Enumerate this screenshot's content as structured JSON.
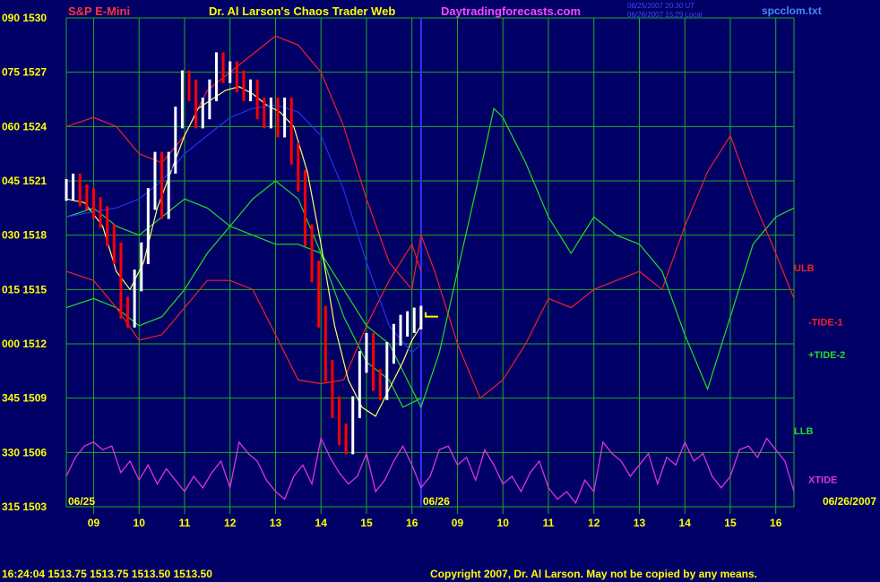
{
  "header": {
    "instrument": "S&P E-Mini",
    "title": "Dr. Al Larson's Chaos Trader Web",
    "site": "Daytradingforecasts.com",
    "stamp_line1": "06/25/2007 20:30 UT",
    "stamp_line2": "06/26/2007 15:29 Local",
    "filename": "spcclom.txt"
  },
  "footer": {
    "quote": "16:24:04  1513.75 1513.75 1513.50 1513.50",
    "copyright": "Copyright 2007, Dr. Al Larson. May not be copied by any means."
  },
  "colors": {
    "background": "#000066",
    "grid": "#22aa22",
    "price_up": "#ffffff",
    "price_down": "#ff0000",
    "ulb": "#ee2222",
    "llb": "#22dd22",
    "tide1": "#ee2222",
    "tide2": "#22dd22",
    "xtide": "#dd33dd",
    "fast_avg": "#ffff66",
    "slow_avg": "#2233ee",
    "labels": "#ffff00",
    "divider": "#3333ff"
  },
  "chart_data": {
    "type": "line",
    "y_labels": [
      {
        "angle": "090",
        "price": 1530
      },
      {
        "angle": "075",
        "price": 1527
      },
      {
        "angle": "060",
        "price": 1524
      },
      {
        "angle": "045",
        "price": 1521
      },
      {
        "angle": "030",
        "price": 1518
      },
      {
        "angle": "015",
        "price": 1515
      },
      {
        "angle": "000",
        "price": 1512
      },
      {
        "angle": "345",
        "price": 1509
      },
      {
        "angle": "330",
        "price": 1506
      },
      {
        "angle": "315",
        "price": 1503
      }
    ],
    "ylim": [
      1503,
      1530
    ],
    "xlim": [
      8.4,
      24.4
    ],
    "x_ticks": [
      {
        "x": 9.0,
        "label": "09"
      },
      {
        "x": 10.0,
        "label": "10"
      },
      {
        "x": 11.0,
        "label": "11"
      },
      {
        "x": 12.0,
        "label": "12"
      },
      {
        "x": 13.0,
        "label": "13"
      },
      {
        "x": 14.0,
        "label": "14"
      },
      {
        "x": 15.0,
        "label": "15"
      },
      {
        "x": 16.0,
        "label": "16"
      },
      {
        "x": 17.0,
        "label": "09"
      },
      {
        "x": 18.0,
        "label": "10"
      },
      {
        "x": 19.0,
        "label": "11"
      },
      {
        "x": 20.0,
        "label": "12"
      },
      {
        "x": 21.0,
        "label": "13"
      },
      {
        "x": 22.0,
        "label": "14"
      },
      {
        "x": 23.0,
        "label": "15"
      },
      {
        "x": 24.0,
        "label": "16"
      }
    ],
    "day_divider_x": 16.2,
    "dates": [
      {
        "x": 8.4,
        "label": "06/25"
      },
      {
        "x": 16.2,
        "label": "06/26"
      },
      {
        "x": 24.4,
        "label": "06/26/2007"
      }
    ],
    "price_series": {
      "name": "price",
      "x": [
        8.4,
        8.55,
        8.7,
        8.85,
        9.0,
        9.15,
        9.3,
        9.45,
        9.6,
        9.75,
        9.9,
        10.05,
        10.2,
        10.35,
        10.5,
        10.65,
        10.8,
        10.95,
        11.1,
        11.25,
        11.4,
        11.55,
        11.7,
        11.85,
        12.0,
        12.15,
        12.3,
        12.45,
        12.6,
        12.75,
        12.9,
        13.05,
        13.2,
        13.35,
        13.5,
        13.65,
        13.8,
        13.95,
        14.1,
        14.25,
        14.4,
        14.55,
        14.7,
        14.85,
        15.0,
        15.15,
        15.3,
        15.45,
        15.6,
        15.75,
        15.9,
        16.05,
        16.2
      ],
      "y": [
        1520.5,
        1520.8,
        1520.2,
        1520.0,
        1519.5,
        1519.0,
        1518.0,
        1517.0,
        1514.0,
        1513.5,
        1515.5,
        1517.0,
        1520.0,
        1522.0,
        1519.5,
        1522.0,
        1524.5,
        1526.5,
        1526.0,
        1524.5,
        1525.0,
        1526.0,
        1527.5,
        1527.0,
        1527.0,
        1526.5,
        1526.0,
        1526.0,
        1525.0,
        1524.5,
        1525.0,
        1524.0,
        1525.0,
        1522.5,
        1521.0,
        1518.0,
        1516.0,
        1513.5,
        1510.5,
        1508.5,
        1507.0,
        1506.5,
        1508.5,
        1511.0,
        1512.0,
        1510.0,
        1509.5,
        1511.5,
        1512.5,
        1513.0,
        1513.2,
        1513.4,
        1513.5
      ]
    },
    "forecast_marker": {
      "x": 16.3,
      "y": 1513.5
    },
    "series": [
      {
        "name": "ULB",
        "x": [
          8.4,
          9.0,
          9.5,
          10.0,
          10.5,
          11.0,
          11.5,
          12.0,
          12.5,
          13.0,
          13.5,
          14.0,
          14.5,
          15.0,
          15.5,
          16.0,
          16.2,
          16.5,
          17.0,
          17.5,
          18.0,
          18.5,
          19.0,
          19.5,
          20.0,
          20.5,
          21.0,
          21.5,
          22.0,
          22.5,
          23.0,
          23.5,
          24.0,
          24.4
        ],
        "y": [
          1524.0,
          1524.5,
          1524.0,
          1522.5,
          1522.0,
          1523.5,
          1526.0,
          1527.0,
          1528.0,
          1529.0,
          1528.5,
          1527.0,
          1524.0,
          1520.0,
          1516.5,
          1515.0,
          1518.0,
          1516.0,
          1512.0,
          1509.0,
          1510.0,
          1512.0,
          1514.5,
          1514.0,
          1515.0,
          1515.5,
          1516.0,
          1515.0,
          1518.5,
          1521.5,
          1523.5,
          1520.0,
          1517.0,
          1514.5
        ]
      },
      {
        "name": "LLB",
        "x": [
          8.4,
          9.0,
          9.5,
          10.0,
          10.5,
          11.0,
          11.5,
          12.0,
          12.5,
          13.0,
          13.5,
          14.0,
          14.5,
          15.0,
          15.5,
          15.8,
          16.2
        ],
        "y": [
          1514.0,
          1514.5,
          1514.0,
          1513.0,
          1513.5,
          1515.0,
          1517.0,
          1518.5,
          1520.0,
          1521.0,
          1520.0,
          1517.0,
          1513.5,
          1511.0,
          1510.0,
          1508.5,
          1509.0
        ]
      },
      {
        "name": "-TIDE-1",
        "x": [
          8.4,
          9.0,
          9.5,
          10.0,
          10.5,
          11.0,
          11.5,
          12.0,
          12.5,
          13.0,
          13.5,
          14.0,
          14.5,
          15.0,
          15.5,
          16.0,
          16.2
        ],
        "y": [
          1516.0,
          1515.5,
          1514.0,
          1512.2,
          1512.5,
          1514.0,
          1515.5,
          1515.5,
          1515.0,
          1512.5,
          1510.0,
          1509.8,
          1510.0,
          1513.0,
          1515.5,
          1517.5,
          1516.0
        ]
      },
      {
        "name": "+TIDE-2",
        "x": [
          8.4,
          9.0,
          9.5,
          10.0,
          10.5,
          11.0,
          11.5,
          12.0,
          12.5,
          13.0,
          13.5,
          14.0,
          14.5,
          15.0,
          15.5,
          16.0,
          16.2,
          16.6,
          17.0,
          17.5,
          17.8,
          18.0,
          18.5,
          19.0,
          19.5,
          20.0,
          20.5,
          21.0,
          21.5,
          22.0,
          22.5,
          23.0,
          23.5,
          24.0,
          24.4
        ],
        "y": [
          1519.0,
          1519.5,
          1518.5,
          1518.0,
          1519.0,
          1520.0,
          1519.5,
          1518.5,
          1518.0,
          1517.5,
          1517.5,
          1517.0,
          1515.0,
          1513.0,
          1512.0,
          1509.5,
          1508.5,
          1511.5,
          1516.0,
          1521.5,
          1525.0,
          1524.5,
          1522.0,
          1519.0,
          1517.0,
          1519.0,
          1518.0,
          1517.5,
          1516.0,
          1512.5,
          1509.5,
          1513.5,
          1517.5,
          1519.0,
          1519.5
        ]
      },
      {
        "name": "fast average",
        "x": [
          8.4,
          8.8,
          9.2,
          9.5,
          9.8,
          10.1,
          10.4,
          10.7,
          11.0,
          11.3,
          11.6,
          11.9,
          12.2,
          12.5,
          12.8,
          13.1,
          13.4,
          13.7,
          14.0,
          14.3,
          14.6,
          14.9,
          15.2,
          15.5,
          15.8,
          16.0,
          16.2
        ],
        "y": [
          1520.0,
          1519.8,
          1518.5,
          1516.0,
          1515.0,
          1516.5,
          1519.5,
          1521.5,
          1523.5,
          1525.0,
          1525.5,
          1526.0,
          1526.2,
          1525.8,
          1525.2,
          1524.8,
          1524.0,
          1521.5,
          1517.5,
          1513.0,
          1510.0,
          1508.5,
          1508.0,
          1509.5,
          1511.0,
          1512.2,
          1513.0
        ]
      },
      {
        "name": "slow average",
        "x": [
          8.4,
          9.0,
          9.5,
          10.0,
          10.5,
          11.0,
          11.5,
          12.0,
          12.5,
          13.0,
          13.5,
          14.0,
          14.5,
          15.0,
          15.5,
          16.0,
          16.2
        ],
        "y": [
          1519.0,
          1519.3,
          1519.5,
          1520.0,
          1521.0,
          1522.5,
          1523.5,
          1524.5,
          1525.0,
          1525.2,
          1524.8,
          1523.5,
          1520.5,
          1516.5,
          1513.0,
          1511.5,
          1512.0
        ]
      }
    ],
    "series_labels": [
      {
        "name": "ULB",
        "y": 1516.2
      },
      {
        "name": "-TIDE-1",
        "y": 1513.2
      },
      {
        "name": "+TIDE-2",
        "y": 1511.4
      },
      {
        "name": "LLB",
        "y": 1507.2
      },
      {
        "name": "XTIDE",
        "y": 1504.5
      }
    ],
    "xtide": {
      "name": "XTIDE",
      "ylim": [
        -1,
        1
      ],
      "x": [
        8.4,
        8.6,
        8.8,
        9.0,
        9.2,
        9.4,
        9.6,
        9.8,
        10.0,
        10.2,
        10.4,
        10.6,
        10.8,
        11.0,
        11.2,
        11.4,
        11.6,
        11.8,
        12.0,
        12.2,
        12.4,
        12.6,
        12.8,
        13.0,
        13.2,
        13.4,
        13.6,
        13.8,
        14.0,
        14.2,
        14.4,
        14.6,
        14.8,
        15.0,
        15.2,
        15.4,
        15.6,
        15.8,
        16.0,
        16.2,
        16.4,
        16.6,
        16.8,
        17.0,
        17.2,
        17.4,
        17.6,
        17.8,
        18.0,
        18.2,
        18.4,
        18.6,
        18.8,
        19.0,
        19.2,
        19.4,
        19.6,
        19.8,
        20.0,
        20.2,
        20.4,
        20.6,
        20.8,
        21.0,
        21.2,
        21.4,
        21.6,
        21.8,
        22.0,
        22.2,
        22.4,
        22.6,
        22.8,
        23.0,
        23.2,
        23.4,
        23.6,
        23.8,
        24.0,
        24.2,
        24.4
      ],
      "y": [
        -0.2,
        0.3,
        0.6,
        0.7,
        0.5,
        0.6,
        -0.1,
        0.2,
        -0.3,
        0.1,
        -0.4,
        0.0,
        -0.3,
        -0.6,
        -0.2,
        -0.5,
        -0.1,
        0.2,
        -0.5,
        0.7,
        0.4,
        0.2,
        -0.3,
        -0.6,
        -0.8,
        -0.2,
        0.1,
        -0.4,
        0.8,
        0.3,
        -0.1,
        -0.4,
        -0.2,
        0.4,
        -0.6,
        -0.3,
        0.2,
        0.6,
        0.1,
        -0.5,
        -0.2,
        0.5,
        0.6,
        0.1,
        0.3,
        -0.3,
        0.5,
        0.1,
        -0.4,
        -0.2,
        -0.6,
        -0.1,
        0.2,
        -0.5,
        -0.8,
        -0.6,
        -0.9,
        -0.3,
        -0.6,
        0.7,
        0.4,
        0.2,
        -0.2,
        0.1,
        0.4,
        -0.4,
        0.3,
        0.1,
        0.7,
        0.2,
        0.4,
        -0.2,
        -0.5,
        -0.2,
        0.5,
        0.6,
        0.3,
        0.8,
        0.5,
        0.2,
        -0.6
      ]
    }
  }
}
